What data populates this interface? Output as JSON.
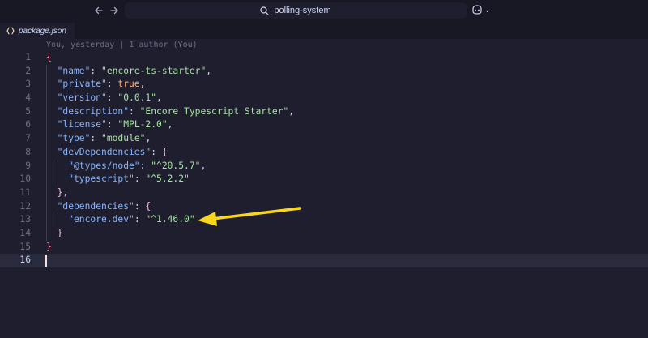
{
  "titlebar": {
    "search_text": "polling-system",
    "back_icon": "arrow-left-icon",
    "forward_icon": "arrow-right-icon",
    "copilot_icon": "copilot-icon",
    "dropdown_glyph": "⌄"
  },
  "tab": {
    "label": "package.json",
    "icon": "json-file-icon"
  },
  "blame": "You, yesterday | 1 author (You)",
  "editor": {
    "active_line": 16,
    "lines": [
      {
        "n": "1",
        "ind": 0,
        "tokens": [
          {
            "t": "{",
            "c": "br1"
          }
        ]
      },
      {
        "n": "2",
        "ind": 1,
        "tokens": [
          {
            "t": "\"name\"",
            "c": "k"
          },
          {
            "t": ": ",
            "c": "p"
          },
          {
            "t": "\"encore-ts-starter\"",
            "c": "s"
          },
          {
            "t": ",",
            "c": "p"
          }
        ]
      },
      {
        "n": "3",
        "ind": 1,
        "tokens": [
          {
            "t": "\"private\"",
            "c": "k"
          },
          {
            "t": ": ",
            "c": "p"
          },
          {
            "t": "true",
            "c": "b"
          },
          {
            "t": ",",
            "c": "p"
          }
        ]
      },
      {
        "n": "4",
        "ind": 1,
        "tokens": [
          {
            "t": "\"version\"",
            "c": "k"
          },
          {
            "t": ": ",
            "c": "p"
          },
          {
            "t": "\"0.0.1\"",
            "c": "s"
          },
          {
            "t": ",",
            "c": "p"
          }
        ]
      },
      {
        "n": "5",
        "ind": 1,
        "tokens": [
          {
            "t": "\"description\"",
            "c": "k"
          },
          {
            "t": ": ",
            "c": "p"
          },
          {
            "t": "\"Encore Typescript Starter\"",
            "c": "s"
          },
          {
            "t": ",",
            "c": "p"
          }
        ]
      },
      {
        "n": "6",
        "ind": 1,
        "tokens": [
          {
            "t": "\"license\"",
            "c": "k"
          },
          {
            "t": ": ",
            "c": "p"
          },
          {
            "t": "\"MPL-2.0\"",
            "c": "s"
          },
          {
            "t": ",",
            "c": "p"
          }
        ]
      },
      {
        "n": "7",
        "ind": 1,
        "tokens": [
          {
            "t": "\"type\"",
            "c": "k"
          },
          {
            "t": ": ",
            "c": "p"
          },
          {
            "t": "\"module\"",
            "c": "s"
          },
          {
            "t": ",",
            "c": "p"
          }
        ]
      },
      {
        "n": "8",
        "ind": 1,
        "tokens": [
          {
            "t": "\"devDependencies\"",
            "c": "k"
          },
          {
            "t": ": ",
            "c": "p"
          },
          {
            "t": "{",
            "c": "br2"
          }
        ]
      },
      {
        "n": "9",
        "ind": 2,
        "tokens": [
          {
            "t": "\"@types/node\"",
            "c": "k"
          },
          {
            "t": ": ",
            "c": "p"
          },
          {
            "t": "\"^20.5.7\"",
            "c": "s"
          },
          {
            "t": ",",
            "c": "p"
          }
        ]
      },
      {
        "n": "10",
        "ind": 2,
        "tokens": [
          {
            "t": "\"typescript\"",
            "c": "k"
          },
          {
            "t": ": ",
            "c": "p"
          },
          {
            "t": "\"^5.2.2\"",
            "c": "s"
          }
        ]
      },
      {
        "n": "11",
        "ind": 1,
        "tokens": [
          {
            "t": "}",
            "c": "br2"
          },
          {
            "t": ",",
            "c": "p"
          }
        ]
      },
      {
        "n": "12",
        "ind": 1,
        "tokens": [
          {
            "t": "\"dependencies\"",
            "c": "k"
          },
          {
            "t": ": ",
            "c": "p"
          },
          {
            "t": "{",
            "c": "br2"
          }
        ]
      },
      {
        "n": "13",
        "ind": 2,
        "tokens": [
          {
            "t": "\"encore.dev\"",
            "c": "k"
          },
          {
            "t": ": ",
            "c": "p"
          },
          {
            "t": "\"^1.46.0\"",
            "c": "s"
          }
        ]
      },
      {
        "n": "14",
        "ind": 1,
        "tokens": [
          {
            "t": "}",
            "c": "br2"
          }
        ]
      },
      {
        "n": "15",
        "ind": 0,
        "tokens": [
          {
            "t": "}",
            "c": "br1"
          }
        ]
      },
      {
        "n": "16",
        "ind": 0,
        "tokens": []
      }
    ]
  },
  "annotation": {
    "color": "#f9d71c",
    "points_to_line": 13
  }
}
